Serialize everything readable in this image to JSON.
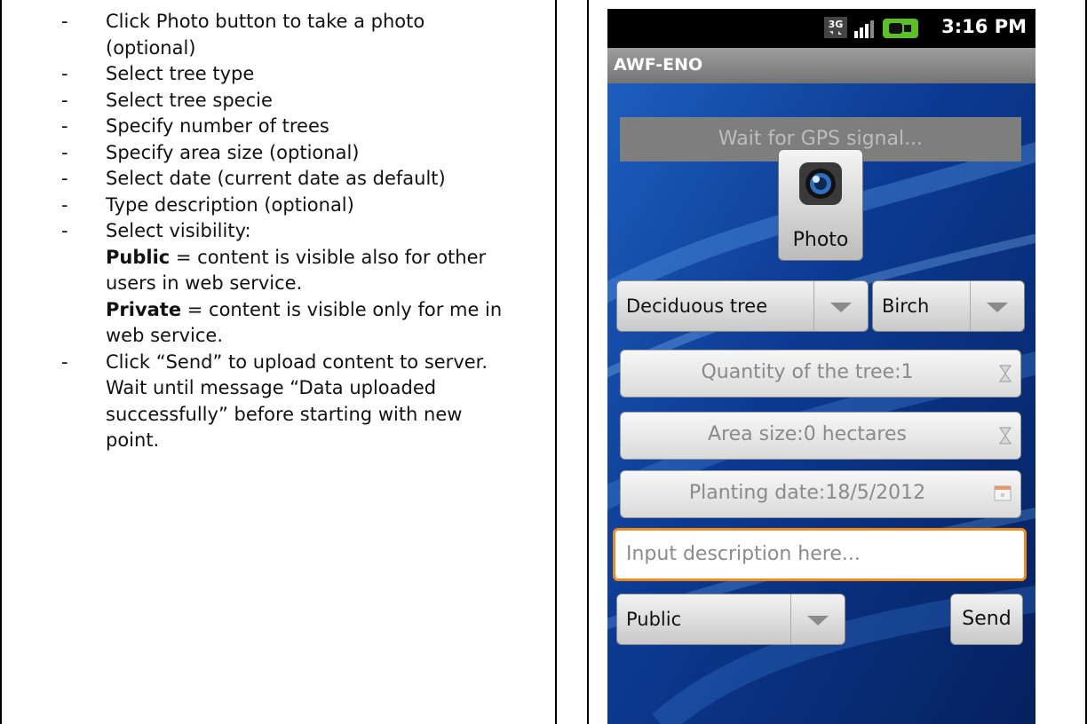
{
  "instructions": {
    "steps": [
      {
        "lines": [
          "Click Photo button to take a photo",
          "(optional)"
        ]
      },
      {
        "lines": [
          "Select tree type"
        ]
      },
      {
        "lines": [
          "Select tree specie"
        ]
      },
      {
        "lines": [
          "Specify number of trees"
        ]
      },
      {
        "lines": [
          "Specify area size (optional)"
        ]
      },
      {
        "lines": [
          "Select date (current date as default)"
        ]
      },
      {
        "lines": [
          "Type description (optional)"
        ]
      }
    ],
    "visibility": {
      "intro": "Select visibility:",
      "public_term": "Public",
      "public_line1": " = content is visible also for other",
      "public_line2": "users in web service.",
      "private_term": "Private",
      "private_line1": " = content is visible only for me in",
      "private_line2": "web service."
    },
    "send_step": {
      "lines": [
        "Click “Send” to upload content to server.",
        "Wait until message “Data uploaded",
        "successfully” before starting with new",
        "point."
      ]
    },
    "dash": "-"
  },
  "phone": {
    "status": {
      "time": "3:16 PM",
      "network": "3G"
    },
    "app_title": "AWF-ENO",
    "gps_status": "Wait for GPS signal...",
    "photo_label": "Photo",
    "tree_type": "Deciduous tree",
    "tree_species": "Birch",
    "quantity": "Quantity of the tree:1",
    "area_size": "Area size:0 hectares",
    "planting_date": "Planting date:18/5/2012",
    "description_placeholder": "Input description here...",
    "visibility": "Public",
    "send_label": "Send"
  },
  "colors": {
    "focus_border": "#f08a1c",
    "battery_green": "#5bbf2a"
  }
}
